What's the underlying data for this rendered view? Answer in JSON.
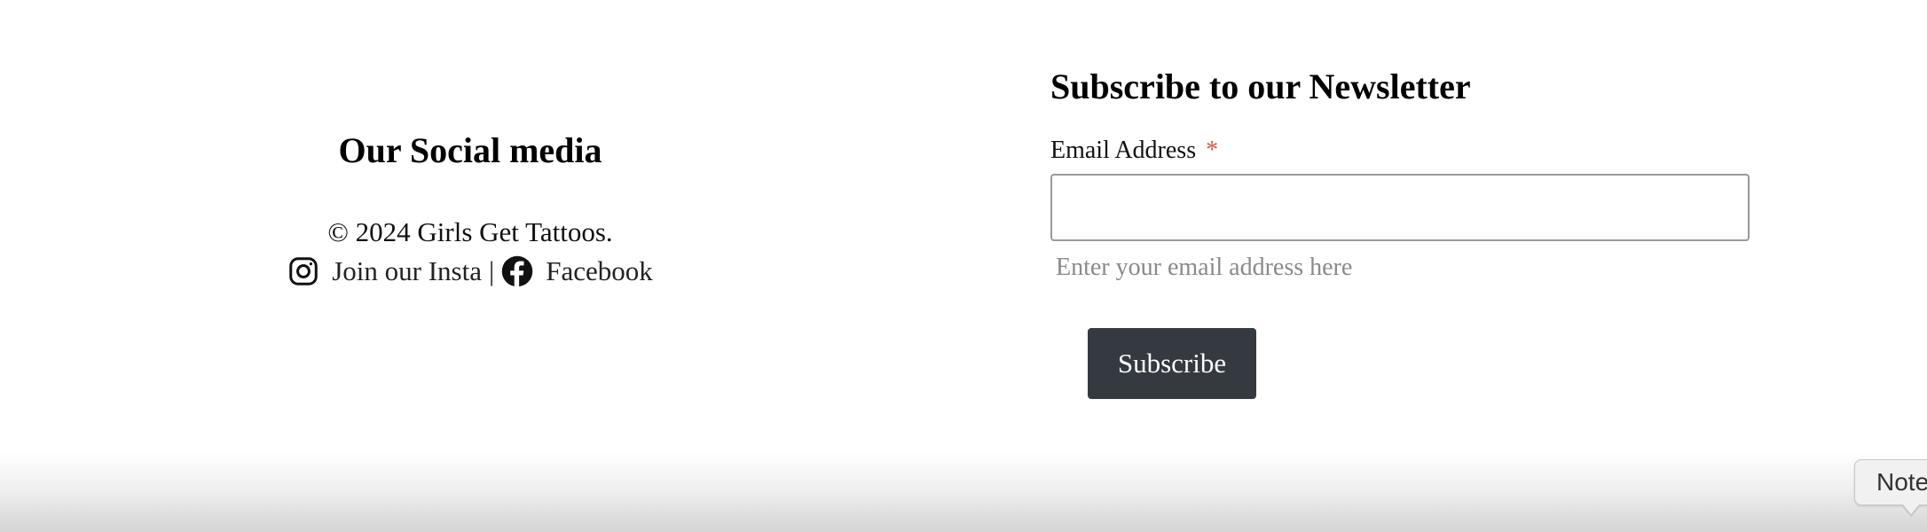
{
  "social": {
    "title": "Our Social media",
    "copyright": "© 2024 Girls Get Tattoos.",
    "instagram_label": "Join our Insta",
    "separator": "|",
    "facebook_label": "Facebook",
    "instagram_icon": "instagram-icon",
    "facebook_icon": "facebook-icon"
  },
  "newsletter": {
    "title": "Subscribe to our Newsletter",
    "email_label": "Email Address",
    "required_marker": "*",
    "email_value": "",
    "help_text": "Enter your email address here",
    "subscribe_label": "Subscribe",
    "colors": {
      "button_bg": "#343a40",
      "required": "#d0573f"
    }
  },
  "bottom_bar": {
    "notes_label": "Note"
  }
}
